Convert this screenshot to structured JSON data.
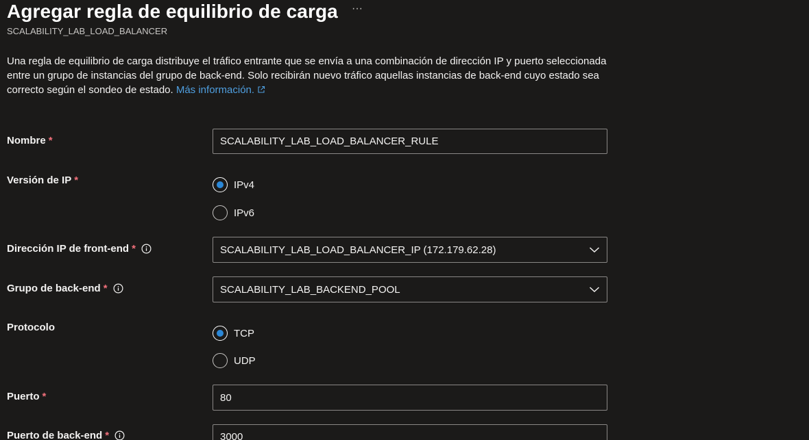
{
  "header": {
    "title": "Agregar regla de equilibrio de carga",
    "subtitle": "SCALABILITY_LAB_LOAD_BALANCER",
    "more_label": "···"
  },
  "description": {
    "text": "Una regla de equilibrio de carga distribuye el tráfico entrante que se envía a una combinación de dirección IP y puerto seleccionada entre un grupo de instancias del grupo de back-end. Solo recibirán nuevo tráfico aquellas instancias de back-end cuyo estado sea correcto según el sondeo de estado.",
    "link_text": "Más información."
  },
  "form": {
    "required_marker": "*",
    "name": {
      "label": "Nombre",
      "value": "SCALABILITY_LAB_LOAD_BALANCER_RULE"
    },
    "ip_version": {
      "label": "Versión de IP",
      "options": [
        {
          "label": "IPv4",
          "selected": true
        },
        {
          "label": "IPv6",
          "selected": false
        }
      ]
    },
    "frontend_ip": {
      "label": "Dirección IP de front-end",
      "value": "SCALABILITY_LAB_LOAD_BALANCER_IP (172.179.62.28)"
    },
    "backend_pool": {
      "label": "Grupo de back-end",
      "value": "SCALABILITY_LAB_BACKEND_POOL"
    },
    "protocol": {
      "label": "Protocolo",
      "options": [
        {
          "label": "TCP",
          "selected": true
        },
        {
          "label": "UDP",
          "selected": false
        }
      ]
    },
    "port": {
      "label": "Puerto",
      "value": "80"
    },
    "backend_port": {
      "label": "Puerto de back-end",
      "value": "3000"
    }
  },
  "colors": {
    "background": "#1b1a19",
    "accent": "#2b88d8",
    "link": "#4f9fe0",
    "required": "#f1707b",
    "border": "#8a8886"
  },
  "icons": {
    "more": "ellipsis-icon",
    "info": "info-icon",
    "external": "external-link-icon",
    "dropdown": "chevron-down-icon"
  }
}
